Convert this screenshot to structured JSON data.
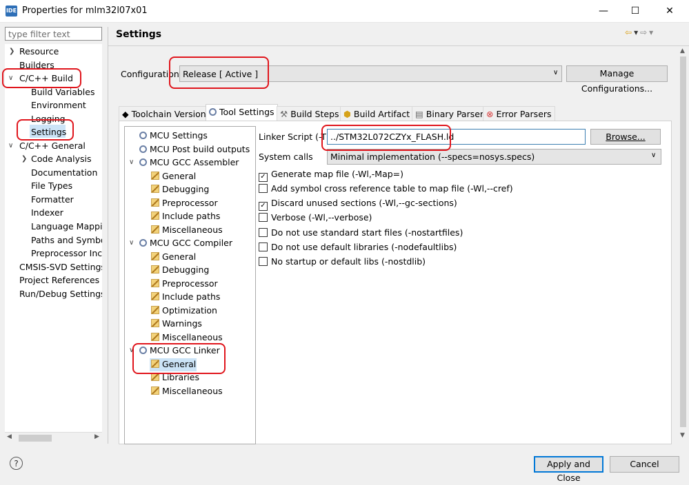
{
  "window": {
    "app_icon_text": "IDE",
    "title": "Properties for mlm32l07x01",
    "minimize_glyph": "—",
    "maximize_glyph": "☐",
    "close_glyph": "✕"
  },
  "filter": {
    "placeholder": "type filter text"
  },
  "left_tree": {
    "items": [
      "Resource",
      "Builders",
      "C/C++ Build",
      "Build Variables",
      "Environment",
      "Logging",
      "Settings",
      "C/C++ General",
      "Code Analysis",
      "Documentation",
      "File Types",
      "Formatter",
      "Indexer",
      "Language Mappin",
      "Paths and Symbols",
      "Preprocessor Inclu",
      "CMSIS-SVD Settings",
      "Project References",
      "Run/Debug Settings"
    ],
    "selected": "Settings"
  },
  "header": {
    "title": "Settings"
  },
  "configuration": {
    "label": "Configuration:",
    "value": "Release  [ Active ]",
    "manage_label": "Manage Configurations..."
  },
  "tabs": [
    {
      "label": "Toolchain Version",
      "icon": "chip-icon"
    },
    {
      "label": "Tool Settings",
      "icon": "gear-icon"
    },
    {
      "label": "Build Steps",
      "icon": "build-steps-icon"
    },
    {
      "label": "Build Artifact",
      "icon": "artifact-icon"
    },
    {
      "label": "Binary Parsers",
      "icon": "binary-parsers-icon"
    },
    {
      "label": "Error Parsers",
      "icon": "error-parsers-icon"
    }
  ],
  "active_tab": "Tool Settings",
  "tool_tree": {
    "items": [
      "MCU Settings",
      "MCU Post build outputs",
      "MCU GCC Assembler",
      "General",
      "Debugging",
      "Preprocessor",
      "Include paths",
      "Miscellaneous",
      "MCU GCC Compiler",
      "General",
      "Debugging",
      "Preprocessor",
      "Include paths",
      "Optimization",
      "Warnings",
      "Miscellaneous",
      "MCU GCC Linker",
      "General",
      "Libraries",
      "Miscellaneous"
    ],
    "selected": "General (MCU GCC Linker)"
  },
  "linker": {
    "script_label": "Linker Script (-T)",
    "script_value": "../STM32L072CZYx_FLASH.ld",
    "browse_label": "Browse...",
    "syscalls_label": "System calls",
    "syscalls_value": "Minimal implementation (--specs=nosys.specs)",
    "options": [
      {
        "label": "Generate map file (-Wl,-Map=)",
        "checked": true
      },
      {
        "label": "Add symbol cross reference table to map file (-Wl,--cref)",
        "checked": false
      },
      {
        "label": "Discard unused sections (-Wl,--gc-sections)",
        "checked": true
      },
      {
        "label": "Verbose (-Wl,--verbose)",
        "checked": false
      },
      {
        "label": "Do not use standard start files (-nostartfiles)",
        "checked": false
      },
      {
        "label": "Do not use default libraries (-nodefaultlibs)",
        "checked": false
      },
      {
        "label": "No startup or default libs (-nostdlib)",
        "checked": false
      }
    ]
  },
  "footer": {
    "help_glyph": "?",
    "apply_label": "Apply and Close",
    "cancel_label": "Cancel"
  },
  "colors": {
    "highlight": "#e0151c",
    "selection": "#cce4f7",
    "focus": "#0078d7"
  }
}
